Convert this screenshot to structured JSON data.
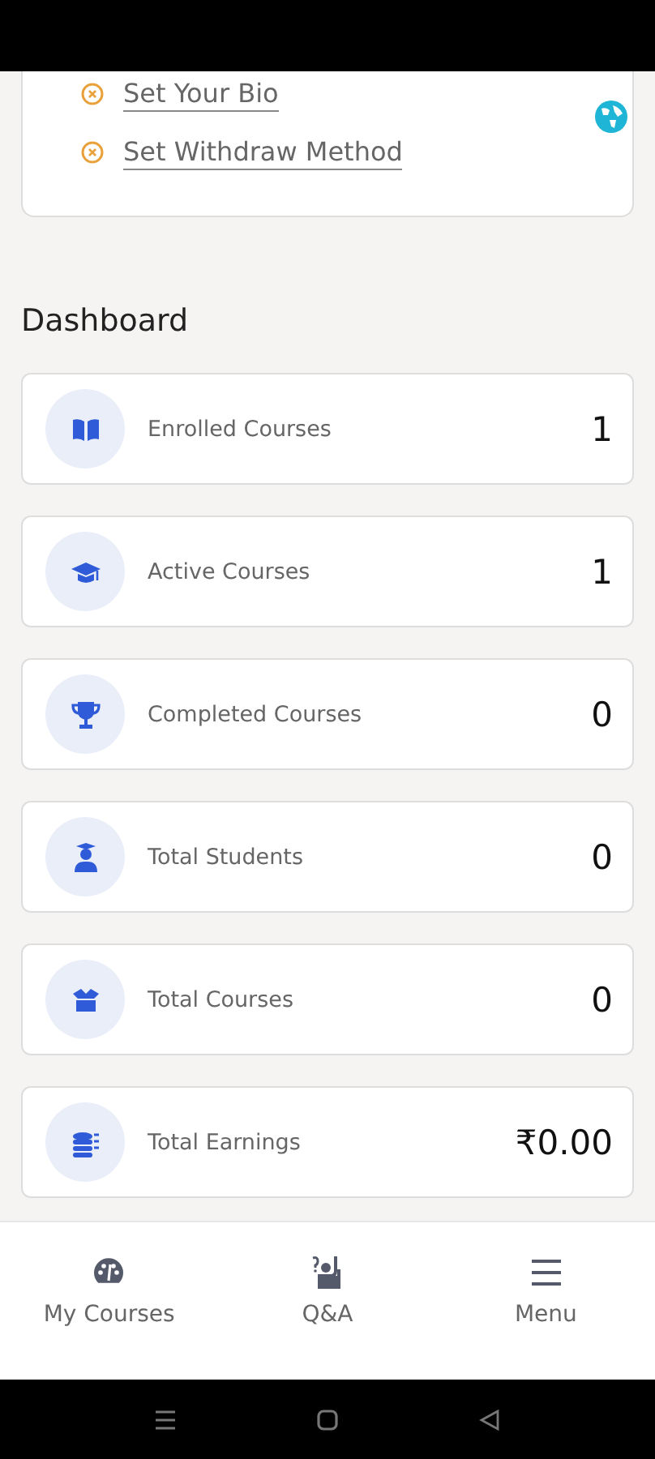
{
  "setup_links": [
    {
      "label": "Set Your Bio"
    },
    {
      "label": "Set Withdraw Method"
    }
  ],
  "section_title": "Dashboard",
  "stats": [
    {
      "label": "Enrolled Courses",
      "value": "1"
    },
    {
      "label": "Active Courses",
      "value": "1"
    },
    {
      "label": "Completed Courses",
      "value": "0"
    },
    {
      "label": "Total Students",
      "value": "0"
    },
    {
      "label": "Total Courses",
      "value": "0"
    },
    {
      "label": "Total Earnings",
      "value": "₹0.00"
    }
  ],
  "bottom_nav": [
    {
      "label": "My Courses"
    },
    {
      "label": "Q&A"
    },
    {
      "label": "Menu"
    }
  ]
}
